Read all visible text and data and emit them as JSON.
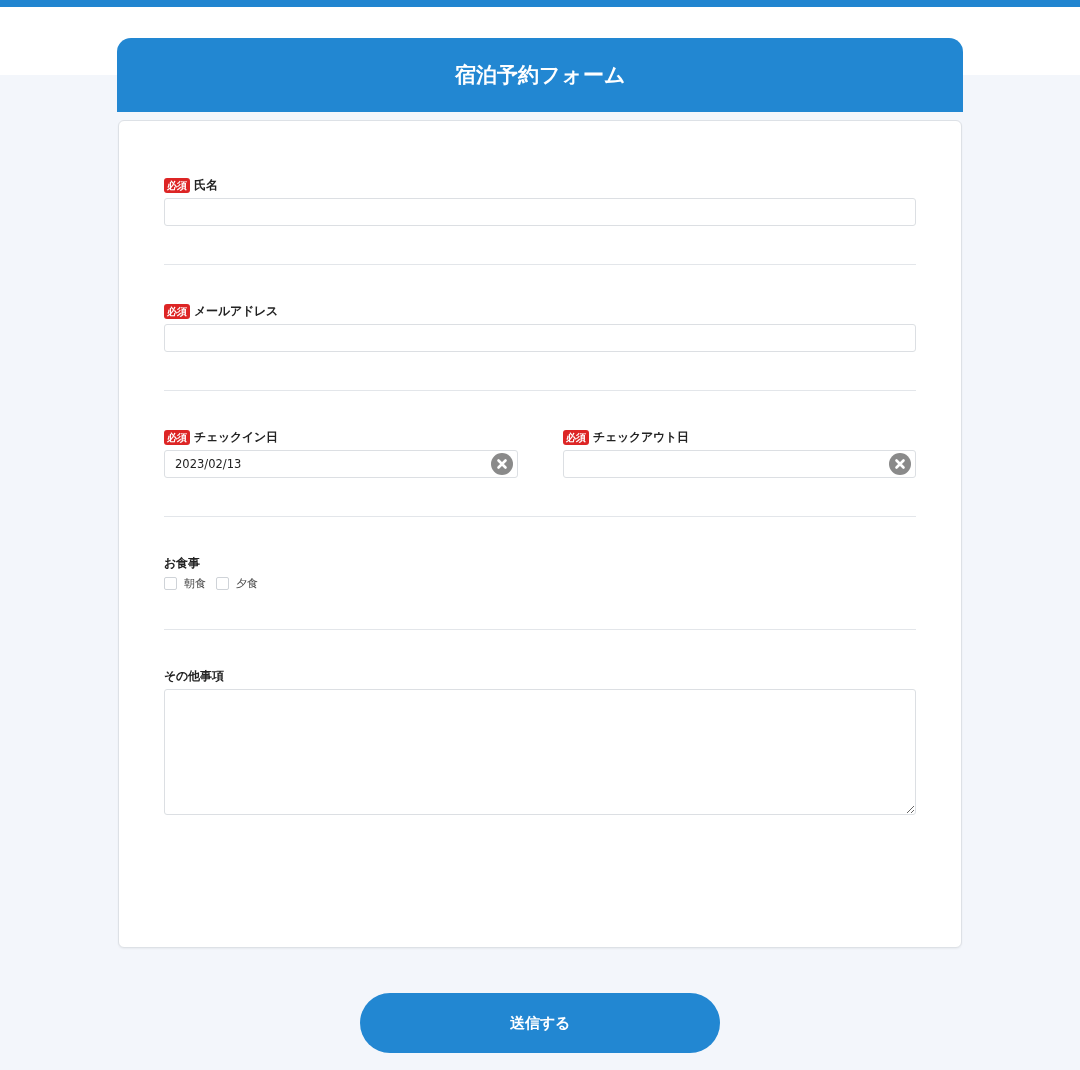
{
  "title": "宿泊予約フォーム",
  "sections": [
    {
      "kind": "input",
      "fields": [
        {
          "badge": "必須",
          "label": "氏名"
        }
      ]
    },
    {
      "kind": "input",
      "fields": [
        {
          "badge": "必須",
          "label": "メールアドレス"
        }
      ]
    },
    {
      "kind": "date",
      "fields": [
        {
          "badge": "必須",
          "label": "チェックイン日",
          "value": "2023/02/13"
        },
        {
          "badge": "必須",
          "label": "チェックアウト日"
        }
      ]
    },
    {
      "kind": "checkboxes",
      "label": "お食事",
      "options": [
        {
          "label": "朝食",
          "checked": false
        },
        {
          "label": "夕食",
          "checked": false
        }
      ]
    },
    {
      "kind": "textarea",
      "fields": [
        {
          "label": "その他事項"
        }
      ]
    }
  ],
  "submit": "送信する"
}
